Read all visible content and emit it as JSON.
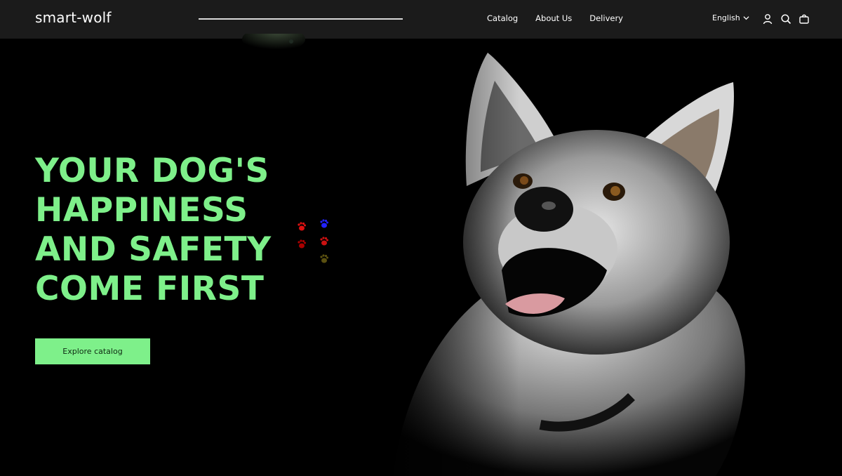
{
  "header": {
    "logo": "smart-wolf",
    "nav": [
      "Catalog",
      "About Us",
      "Delivery"
    ],
    "language": "English",
    "icons": [
      "account-icon",
      "search-icon",
      "cart-icon"
    ]
  },
  "hero": {
    "headline": [
      "YOUR DOG'S",
      "HAPPINESS",
      "AND SAFETY",
      "COME FIRST"
    ],
    "cta_label": "Explore catalog",
    "accent_color": "#7ef08a"
  }
}
